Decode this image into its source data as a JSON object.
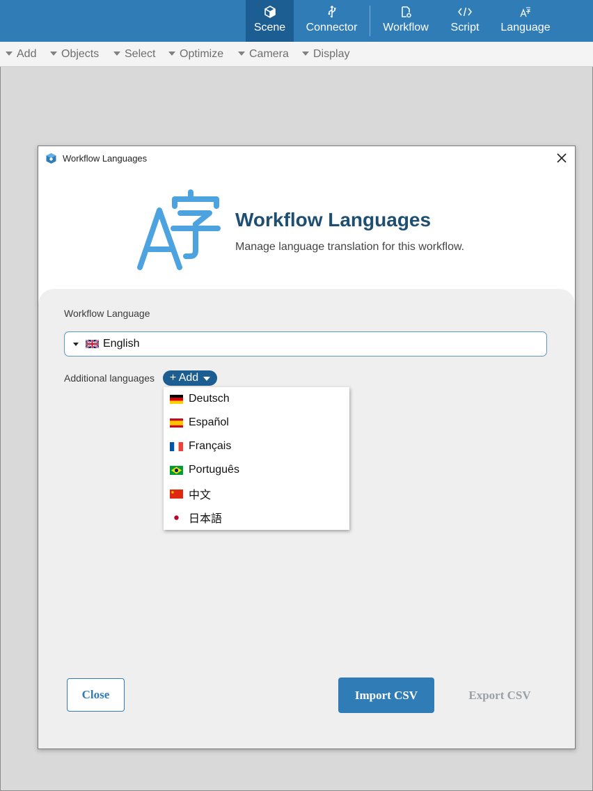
{
  "topbar": {
    "tabs": [
      {
        "label": "Scene",
        "icon": "cube-icon",
        "active": true
      },
      {
        "label": "Connector",
        "icon": "usb-icon",
        "active": false
      },
      {
        "label": "Workflow",
        "icon": "workflow-icon",
        "active": false
      },
      {
        "label": "Script",
        "icon": "code-icon",
        "active": false
      },
      {
        "label": "Language",
        "icon": "language-icon",
        "active": false
      }
    ],
    "accent": "#2f7cb7",
    "active_bg": "#1c5e91"
  },
  "menubar": {
    "items": [
      "Add",
      "Objects",
      "Select",
      "Optimize",
      "Camera",
      "Display"
    ]
  },
  "dialog": {
    "window_title": "Workflow Languages",
    "heading": "Workflow Languages",
    "subheading": "Manage language translation for this workflow.",
    "workflow_language_label": "Workflow Language",
    "workflow_language_value": "English",
    "workflow_language_flag": "uk-flag-icon",
    "additional_languages_label": "Additional languages",
    "add_button_label": "+ Add",
    "languages": [
      {
        "label": "Deutsch",
        "flag": "germany-flag-icon"
      },
      {
        "label": "Español",
        "flag": "spain-flag-icon"
      },
      {
        "label": "Français",
        "flag": "france-flag-icon"
      },
      {
        "label": "Português",
        "flag": "brazil-flag-icon"
      },
      {
        "label": "中文",
        "flag": "china-flag-icon"
      },
      {
        "label": "日本語",
        "flag": "japan-flag-icon"
      }
    ],
    "buttons": {
      "close": "Close",
      "import": "Import CSV",
      "export": "Export CSV"
    },
    "heading_color": "#1e4f72",
    "logo_color": "#4ca3df"
  }
}
